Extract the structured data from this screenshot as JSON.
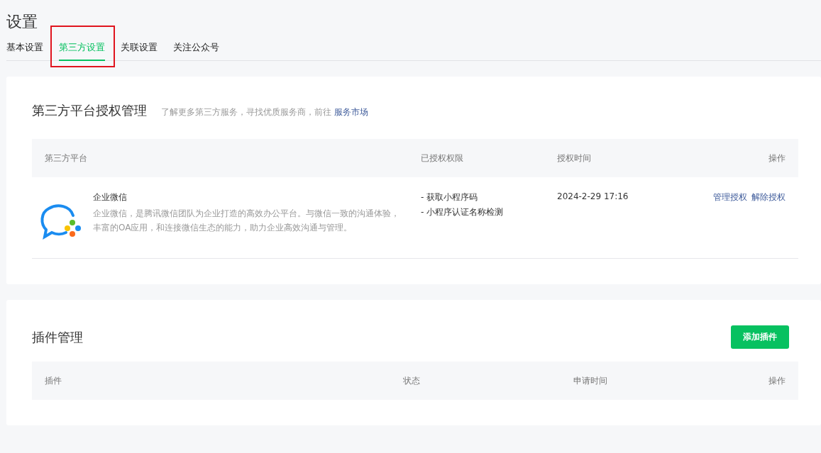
{
  "page": {
    "title": "设置"
  },
  "tabs": [
    {
      "label": "基本设置",
      "selected": false
    },
    {
      "label": "第三方设置",
      "selected": true
    },
    {
      "label": "关联设置",
      "selected": false
    },
    {
      "label": "关注公众号",
      "selected": false
    }
  ],
  "auth_section": {
    "title": "第三方平台授权管理",
    "hint": "了解更多第三方服务，寻找优质服务商，前往",
    "link": "服务市场",
    "columns": [
      "第三方平台",
      "已授权权限",
      "授权时间",
      "操作"
    ],
    "rows": [
      {
        "name": "企业微信",
        "description": "企业微信，是腾讯微信团队为企业打造的高效办公平台。与微信一致的沟通体验，丰富的OA应用，和连接微信生态的能力，助力企业高效沟通与管理。",
        "permissions": [
          "- 获取小程序码",
          "- 小程序认证名称检测"
        ],
        "time": "2024-2-29 17:16",
        "actions": [
          "管理授权",
          "解除授权"
        ]
      }
    ]
  },
  "plugin_section": {
    "title": "插件管理",
    "add_button": "添加插件",
    "columns": [
      "插件",
      "状态",
      "申请时间",
      "操作"
    ]
  }
}
